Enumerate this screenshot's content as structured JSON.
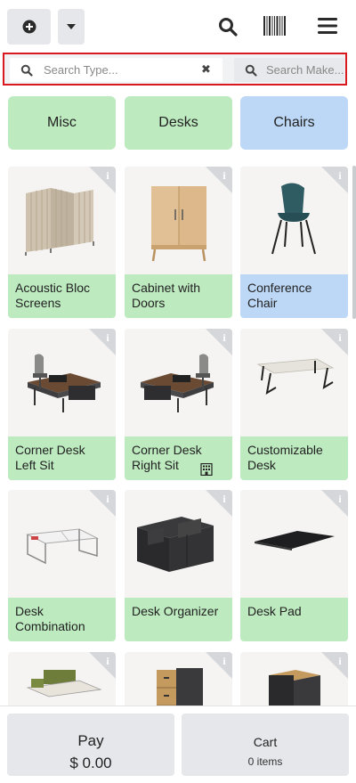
{
  "topbar": {
    "new_icon": "plus-circle-icon",
    "dropdown_icon": "caret-down-icon",
    "search_icon": "search-icon",
    "barcode_icon": "barcode-icon",
    "menu_icon": "hamburger-menu-icon"
  },
  "search": {
    "type_placeholder": "Search Type...",
    "type_value": "",
    "clear_glyph": "✖",
    "make_placeholder": "Search Make..."
  },
  "categories": [
    {
      "label": "Misc",
      "color": "#bdeabf"
    },
    {
      "label": "Desks",
      "color": "#bdeabf"
    },
    {
      "label": "Chairs",
      "color": "#bdd8f6"
    }
  ],
  "products": [
    {
      "name": "Acoustic Bloc Screens",
      "color": "green",
      "image": "screen-panels-icon"
    },
    {
      "name": "Cabinet with Doors",
      "color": "green",
      "image": "cabinet-icon"
    },
    {
      "name": "Conference Chair",
      "color": "blue",
      "image": "chair-icon"
    },
    {
      "name": "Corner Desk Left Sit",
      "color": "green",
      "image": "corner-desk-icon"
    },
    {
      "name": "Corner Desk Right Sit",
      "color": "green",
      "image": "corner-desk-icon",
      "badge": "building-icon"
    },
    {
      "name": "Customizable Desk",
      "color": "green",
      "image": "desk-icon"
    },
    {
      "name": "Desk Combination",
      "color": "green",
      "image": "desk-combo-icon"
    },
    {
      "name": "Desk Organizer",
      "color": "green",
      "image": "organizer-icon"
    },
    {
      "name": "Desk Pad",
      "color": "green",
      "image": "desk-pad-icon"
    },
    {
      "name": "",
      "color": "green",
      "image": "bench-icon"
    },
    {
      "name": "",
      "color": "green",
      "image": "drawer-unit-icon"
    },
    {
      "name": "",
      "color": "green",
      "image": "pedestal-icon"
    }
  ],
  "footer": {
    "pay_label": "Pay",
    "pay_amount": "$ 0.00",
    "cart_label": "Cart",
    "cart_count": "0 items"
  },
  "colors": {
    "green": "#bdeabf",
    "blue": "#bdd8f6",
    "button_gray": "#e5e7ea",
    "highlight_red": "#d9191f"
  }
}
